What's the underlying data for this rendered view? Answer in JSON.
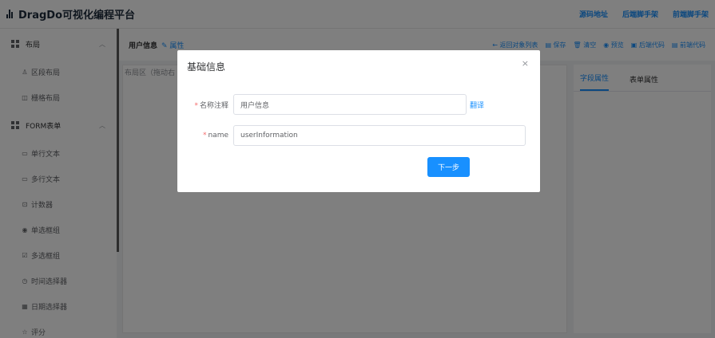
{
  "header": {
    "title": "DragDo可视化编程平台",
    "links": [
      "源码地址",
      "后端脚手架",
      "前端脚手架"
    ]
  },
  "sidebar": {
    "groups": [
      {
        "label": "布局",
        "items": [
          {
            "icon": "section-layout-icon",
            "label": "区段布局"
          },
          {
            "icon": "grid-layout-icon",
            "label": "栅格布局"
          }
        ]
      },
      {
        "label": "FORM表单",
        "items": [
          {
            "icon": "single-line-text-icon",
            "label": "单行文本"
          },
          {
            "icon": "multi-line-text-icon",
            "label": "多行文本"
          },
          {
            "icon": "counter-icon",
            "label": "计数器"
          },
          {
            "icon": "radio-icon",
            "label": "单选框组"
          },
          {
            "icon": "checkbox-icon",
            "label": "多选框组"
          },
          {
            "icon": "clock-icon",
            "label": "时间选择器"
          },
          {
            "icon": "calendar-icon",
            "label": "日期选择器"
          },
          {
            "icon": "star-icon",
            "label": "评分"
          }
        ]
      }
    ]
  },
  "toolbar": {
    "title": "用户信息",
    "attr_link": "属性",
    "actions": [
      "返回对象列表",
      "保存",
      "清空",
      "预览",
      "后端代码",
      "前端代码"
    ]
  },
  "canvas": {
    "label": "布局区（拖动右"
  },
  "right_panel": {
    "tabs": [
      "字段属性",
      "表单属性"
    ]
  },
  "modal": {
    "title": "基础信息",
    "close_symbol": "×",
    "fields": [
      {
        "label": "名称注释",
        "value": "用户信息",
        "extra": "翻译"
      },
      {
        "label": "name",
        "value": "userInformation"
      }
    ],
    "next_button": "下一步"
  },
  "colors": {
    "accent": "#1890ff",
    "danger": "#f56c6c",
    "overlay": "rgba(0,0,0,0.5)"
  }
}
